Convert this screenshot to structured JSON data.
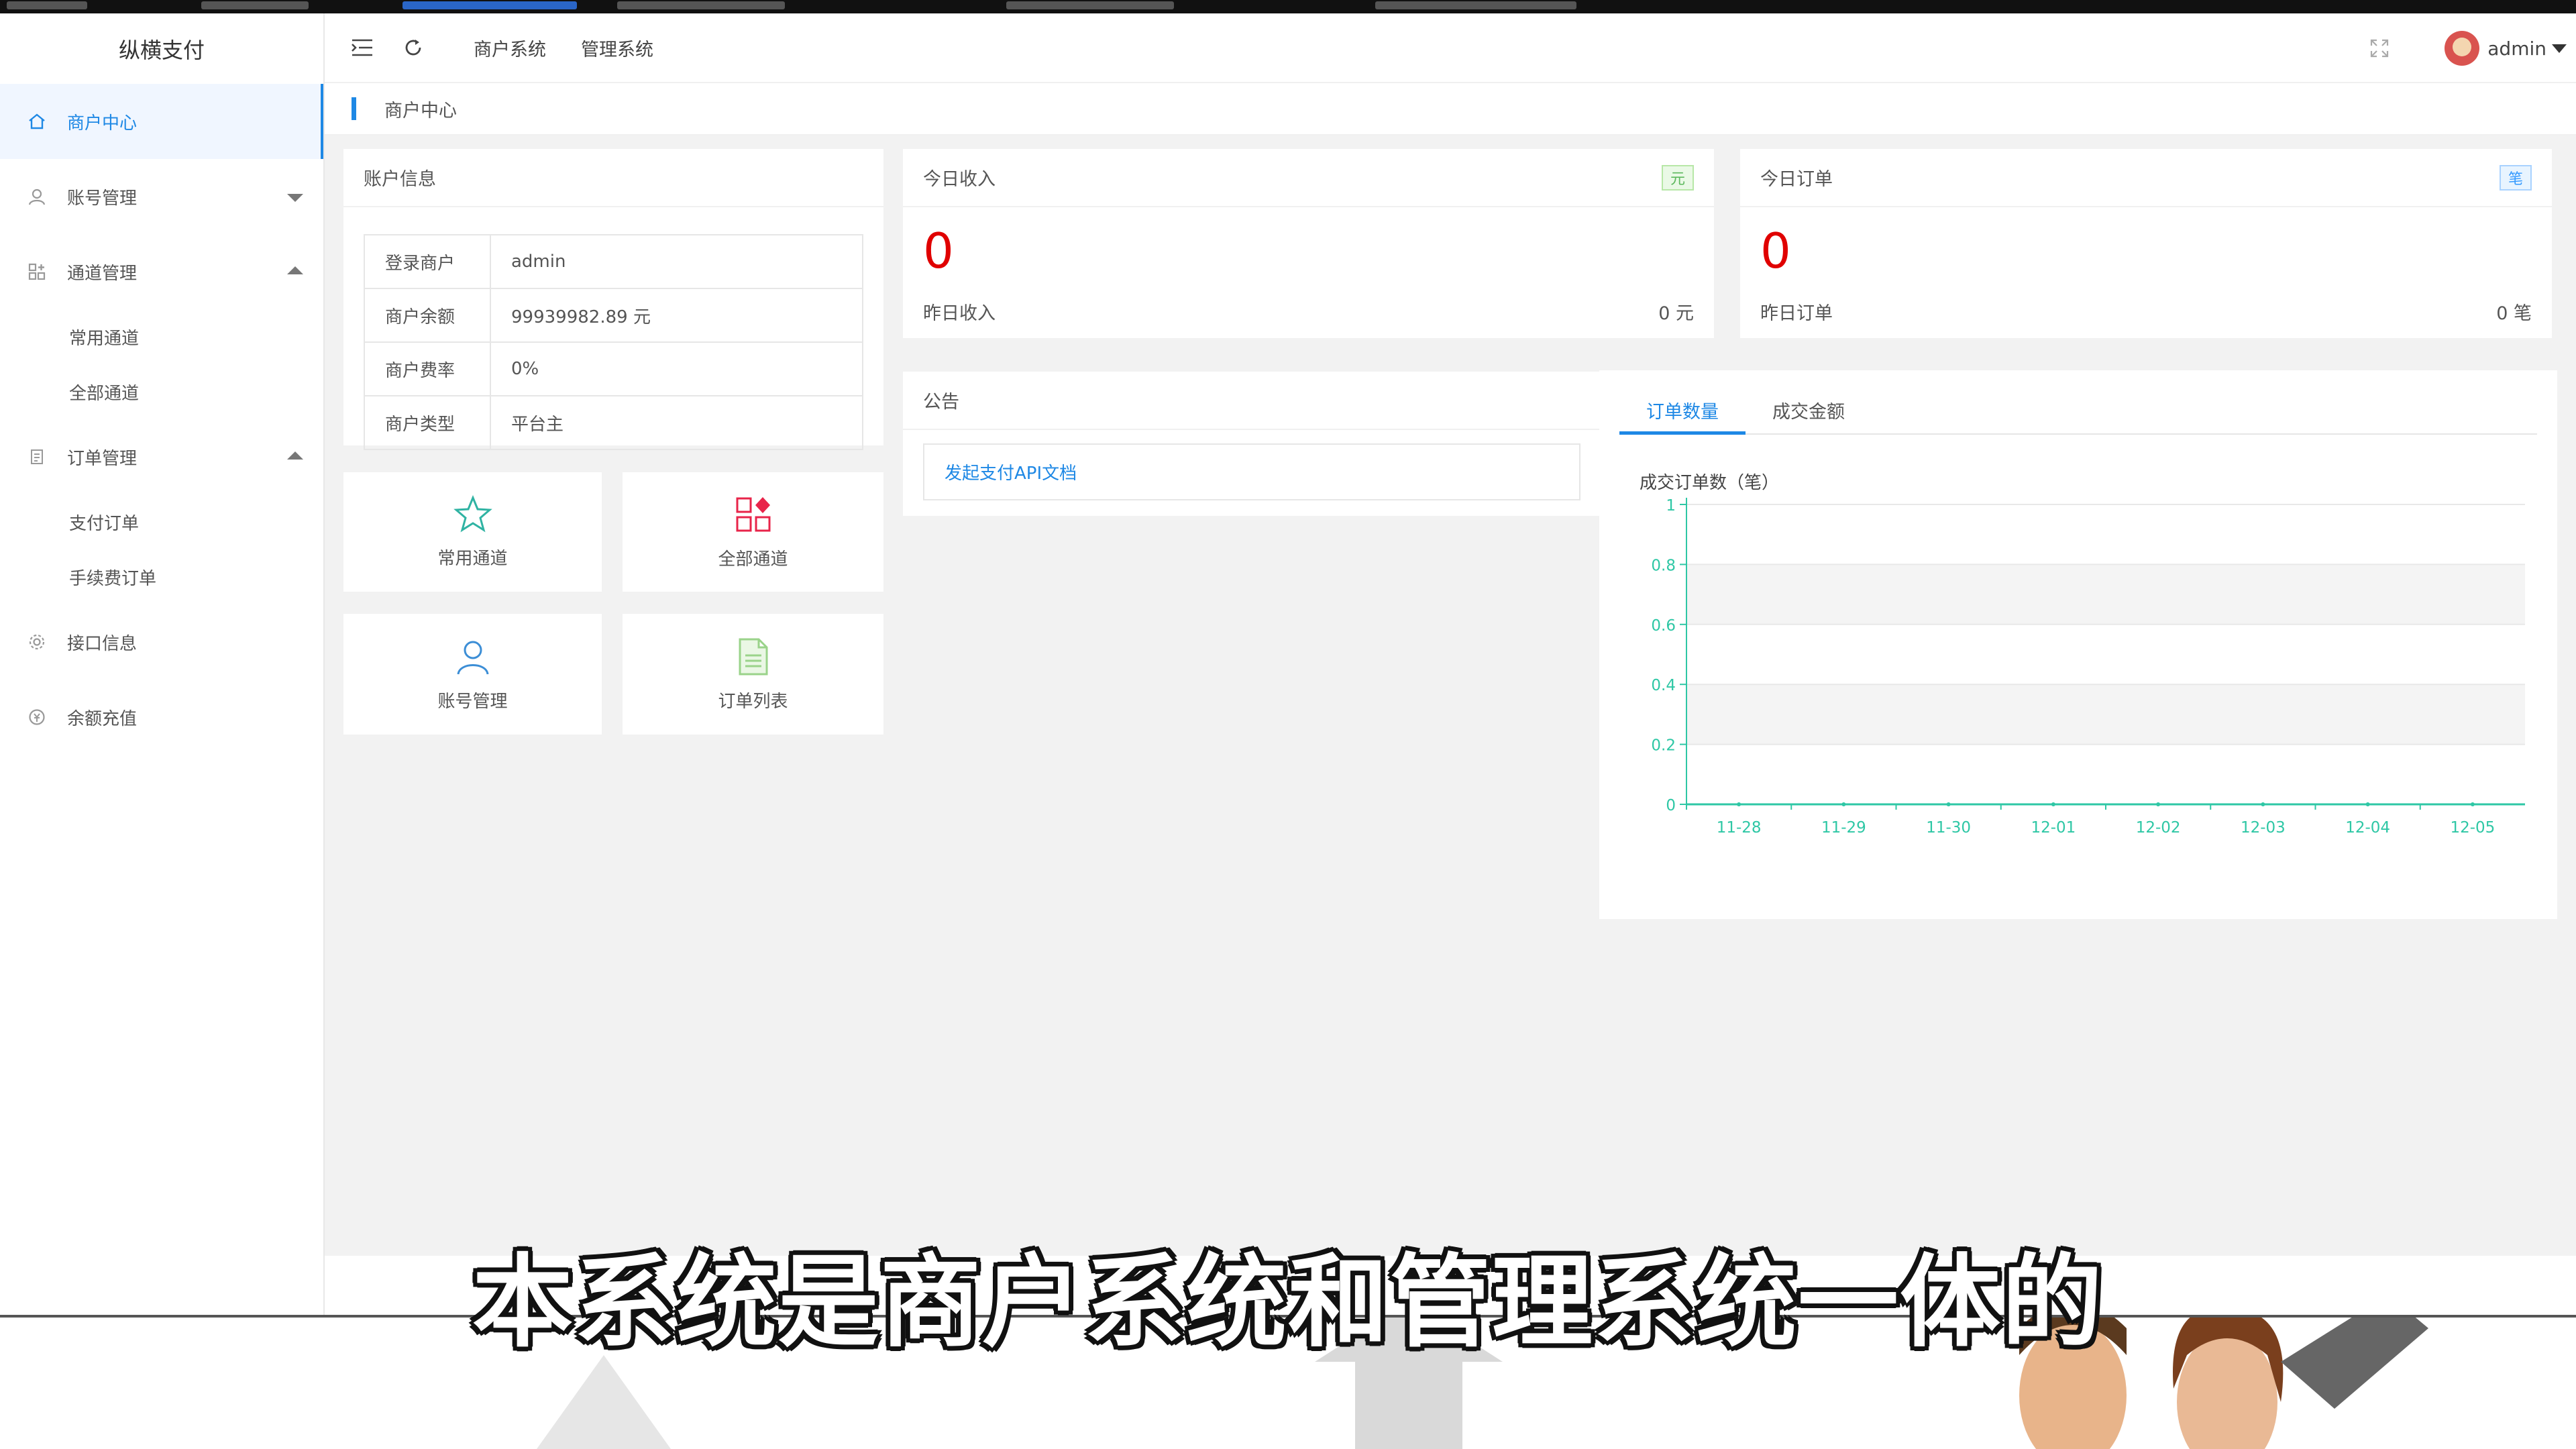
{
  "app": {
    "logo_text": "纵横支付"
  },
  "header": {
    "nav": [
      "商户系统",
      "管理系统"
    ],
    "user": "admin"
  },
  "sidebar": {
    "items": [
      {
        "label": "商户中心",
        "active": true
      },
      {
        "label": "账号管理"
      },
      {
        "label": "通道管理",
        "children": [
          "常用通道",
          "全部通道"
        ]
      },
      {
        "label": "订单管理",
        "children": [
          "支付订单",
          "手续费订单"
        ]
      },
      {
        "label": "接口信息"
      },
      {
        "label": "余额充值"
      }
    ]
  },
  "breadcrumb": "商户中心",
  "account": {
    "title": "账户信息",
    "rows": [
      {
        "key": "登录商户",
        "value": "admin"
      },
      {
        "key": "商户余额",
        "value": "99939982.89 元"
      },
      {
        "key": "商户费率",
        "value": "0%"
      },
      {
        "key": "商户类型",
        "value": "平台主"
      }
    ]
  },
  "income": {
    "title": "今日收入",
    "badge": "元",
    "value": "0",
    "sub_label": "昨日收入",
    "sub_value": "0 元"
  },
  "orders": {
    "title": "今日订单",
    "badge": "笔",
    "value": "0",
    "sub_label": "昨日订单",
    "sub_value": "0 笔"
  },
  "notice": {
    "title": "公告",
    "link": "发起支付API文档"
  },
  "tiles": [
    "常用通道",
    "全部通道",
    "账号管理",
    "订单列表"
  ],
  "chart_tabs": [
    "订单数量",
    "成交金额"
  ],
  "chart_data": {
    "type": "line",
    "title": "成交订单数（笔）",
    "categories": [
      "11-28",
      "11-29",
      "11-30",
      "12-01",
      "12-02",
      "12-03",
      "12-04",
      "12-05"
    ],
    "series": [
      {
        "values": [
          0,
          0,
          0,
          0,
          0,
          0,
          0,
          0
        ]
      }
    ],
    "ylim": [
      0,
      1
    ],
    "yticks": [
      "0",
      "0.2",
      "0.4",
      "0.6",
      "0.8",
      "1"
    ],
    "grid": true,
    "color": "#2ec7a5"
  },
  "caption": "本系统是商户系统和管理系统一体的",
  "colors": {
    "accent": "#1e88e5",
    "stat_value": "#e00000",
    "chart_line": "#2ec7a5"
  }
}
